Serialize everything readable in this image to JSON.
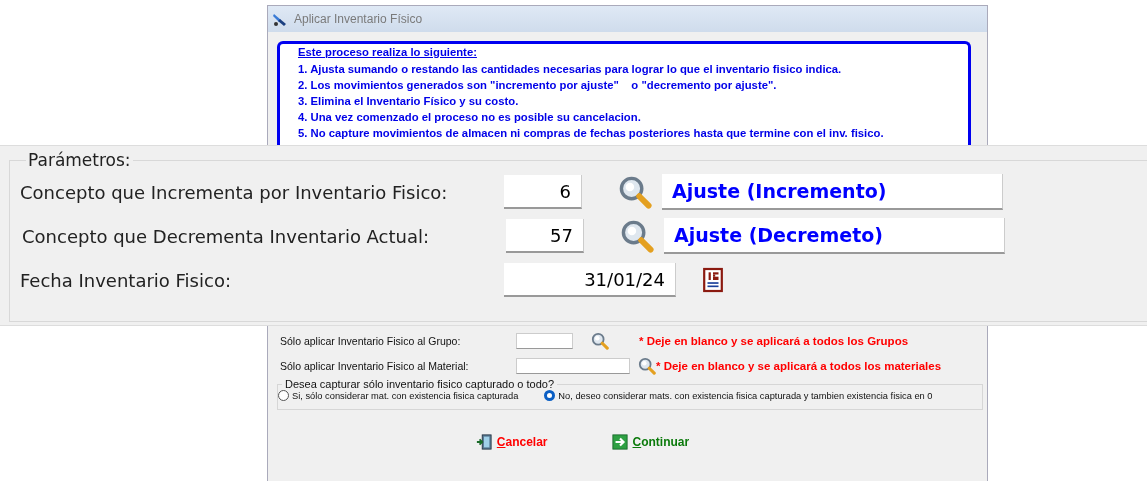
{
  "window": {
    "title": "Aplicar Inventario Físico"
  },
  "info": {
    "heading": "Este proceso realiza lo siguiente:",
    "lines": [
      "1. Ajusta sumando o restando las cantidades necesarias para lograr lo que el inventario fisico indica.",
      "2. Los movimientos generados son \"incremento por ajuste\"    o \"decremento por ajuste\".",
      "3. Elimina el Inventario Físico y su costo.",
      "4. Una vez comenzado el proceso no es posible su cancelacion.",
      "5. No capture movimientos de almacen ni compras de fechas posteriores hasta que termine con el inv. fisico."
    ]
  },
  "parametros": {
    "title": "Parámetros:",
    "rows": [
      {
        "kind": "concept",
        "label": "Concepto que Incrementa por Inventario Fisico:",
        "value": "6",
        "description": "Ajuste (Incremento)"
      },
      {
        "kind": "concept",
        "label": "Concepto que Decrementa Inventario Actual:",
        "value": "57",
        "description": "Ajuste (Decremeto)"
      },
      {
        "kind": "date",
        "label": "Fecha Inventario Fisico:",
        "value": "31/01/24"
      }
    ]
  },
  "filters": [
    {
      "label": "Sólo aplicar Inventario Fisico al Grupo:",
      "note": "* Deje en blanco y se aplicará a todos los Grupos"
    },
    {
      "label": "Sólo aplicar Inventario Fisico al Material:",
      "note": "* Deje en blanco y se aplicará a todos los materiales"
    }
  ],
  "capture": {
    "title": "Desea capturar sólo inventario fisico capturado o todo?",
    "options": [
      {
        "label": "Si, sólo considerar mat. con existencia fisica capturada",
        "selected": false
      },
      {
        "label": "No, deseo considerar mats. con existencia fisica capturada y tambien existencia fisica en 0",
        "selected": true
      }
    ]
  },
  "buttons": [
    {
      "kind": "cancel",
      "label": "Cancelar"
    },
    {
      "kind": "continue",
      "label": "Continuar"
    }
  ]
}
